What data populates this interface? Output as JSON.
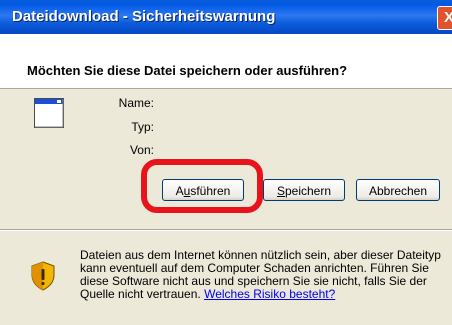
{
  "window": {
    "title": "Dateidownload - Sicherheitswarnung",
    "close_label": "X"
  },
  "dialog": {
    "question": "Möchten Sie diese Datei speichern oder ausführen?",
    "fields": {
      "name_label": "Name:",
      "type_label": "Typ:",
      "from_label": "Von:"
    }
  },
  "buttons": {
    "run": {
      "prefix": "A",
      "accesskey": "u",
      "rest": "sführen"
    },
    "save": {
      "accesskey": "S",
      "rest": "peichern"
    },
    "cancel": "Abbrechen"
  },
  "warning": {
    "text": "Dateien aus dem Internet können nützlich sein, aber dieser Dateityp kann eventuell auf dem Computer Schaden anrichten. Führen Sie diese Software nicht aus und speichern Sie sie nicht, falls Sie der Quelle nicht vertrauen.",
    "link_label": "Welches Risiko besteht?"
  },
  "colors": {
    "titlebar": "#0A5FD6",
    "dialog_bg": "#ECE9D8",
    "highlight": "#E8141C",
    "link": "#0000EE"
  },
  "icons": {
    "file": "application-window-icon",
    "shield": "security-shield-icon",
    "close": "close-icon"
  }
}
